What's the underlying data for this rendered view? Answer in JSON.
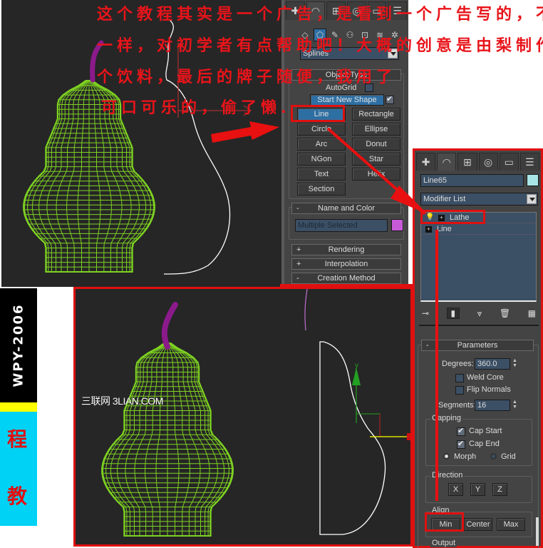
{
  "overlay_text": {
    "line1": "这个教程其实是一个广告，是看到一个广告写的，不完全",
    "line2": "一样，对初学者有点帮助吧！大概的创意是由梨制作成一",
    "line3": "个饮料，最后的牌子随便，我用了",
    "line4": "可口可乐的，偷了懒."
  },
  "banner": {
    "label": "WPY-2006",
    "cn_top": "程",
    "cn_bottom": "教",
    "colors": {
      "black": "#000000",
      "yellow": "#ffff00",
      "cyan": "#00d2f5",
      "red": "#e01010"
    }
  },
  "watermark": "三联网 3LIAN.COM",
  "create_panel": {
    "tabs": [
      "create-tab",
      "modify-tab",
      "hierarchy-tab",
      "motion-tab",
      "display-tab",
      "utilities-tab"
    ],
    "subcategories": [
      "geometry",
      "shapes",
      "lights",
      "cameras",
      "helpers",
      "space-warps",
      "systems"
    ],
    "category_dropdown": "Splines",
    "object_type": {
      "title": "Object Type",
      "minus": "-",
      "autogrid_label": "AutoGrid",
      "start_new_shape": "Start New Shape",
      "buttons": [
        "Line",
        "Rectangle",
        "Circle",
        "Ellipse",
        "Arc",
        "Donut",
        "NGon",
        "Star",
        "Text",
        "Helix",
        "Section"
      ],
      "active_button": "Line"
    },
    "name_and_color": {
      "title": "Name and Color",
      "minus": "-",
      "name_value": "Multiple Selected",
      "color": "#c85ad8"
    },
    "rollouts": [
      {
        "sign": "+",
        "title": "Rendering"
      },
      {
        "sign": "+",
        "title": "Interpolation"
      },
      {
        "sign": "-",
        "title": "Creation Method"
      }
    ]
  },
  "modify_panel": {
    "object_name": "Line65",
    "object_color": "#a8e6e6",
    "modifier_list": "Modifier List",
    "stack": [
      {
        "label": "Lathe",
        "highlighted": true
      },
      {
        "label": "Line",
        "highlighted": false
      }
    ],
    "stack_tools": [
      "pin-stack",
      "show-end-result",
      "make-unique",
      "remove-modifier",
      "configure-modifier-sets"
    ],
    "parameters": {
      "title": "Parameters",
      "minus": "-",
      "degrees_label": "Degrees:",
      "degrees_value": "360.0",
      "weld_core": "Weld Core",
      "flip_normals": "Flip Normals",
      "segments_label": "Segments:",
      "segments_value": "16",
      "capping_title": "Capping",
      "cap_start": "Cap Start",
      "cap_end": "Cap End",
      "morph": "Morph",
      "grid": "Grid",
      "direction_title": "Direction",
      "direction_buttons": [
        "X",
        "Y",
        "Z"
      ],
      "align_title": "Align",
      "align_buttons": [
        "Min",
        "Center",
        "Max"
      ],
      "output_title": "Output"
    }
  }
}
